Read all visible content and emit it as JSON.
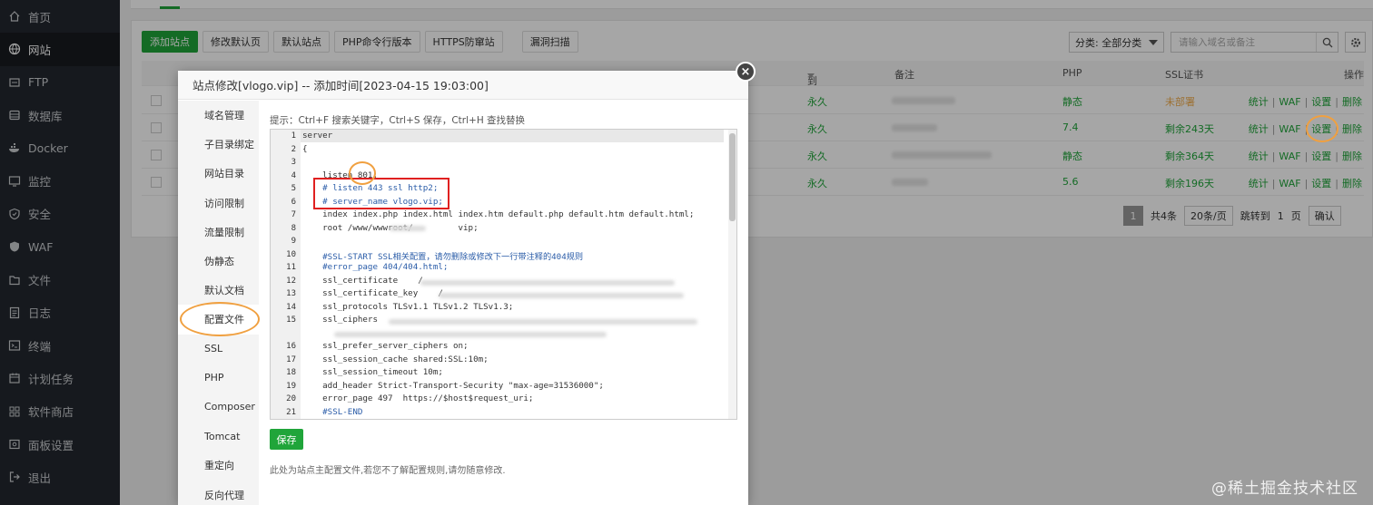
{
  "sidebar": {
    "items": [
      {
        "label": "首页",
        "icon": "home-icon"
      },
      {
        "label": "网站",
        "icon": "globe-icon",
        "active": true
      },
      {
        "label": "FTP",
        "icon": "ftp-icon"
      },
      {
        "label": "数据库",
        "icon": "database-icon"
      },
      {
        "label": "Docker",
        "icon": "docker-icon"
      },
      {
        "label": "监控",
        "icon": "monitor-icon"
      },
      {
        "label": "安全",
        "icon": "shield-icon"
      },
      {
        "label": "WAF",
        "icon": "waf-shield-icon"
      },
      {
        "label": "文件",
        "icon": "folder-icon"
      },
      {
        "label": "日志",
        "icon": "log-icon"
      },
      {
        "label": "终端",
        "icon": "terminal-icon"
      },
      {
        "label": "计划任务",
        "icon": "calendar-icon"
      },
      {
        "label": "软件商店",
        "icon": "store-icon"
      },
      {
        "label": "面板设置",
        "icon": "settings-icon"
      },
      {
        "label": "退出",
        "icon": "logout-icon"
      }
    ]
  },
  "toolbar": {
    "add_site": "添加站点",
    "modify_default": "修改默认页",
    "default_site": "默认站点",
    "php_cli": "PHP命令行版本",
    "https_protect": "HTTPS防窜站",
    "vuln_scan": "漏洞扫描",
    "category_select": "分类: 全部分类",
    "search_placeholder": "请输入域名或备注"
  },
  "table": {
    "headers": {
      "expire": "到期时间",
      "remark": "备注",
      "php": "PHP",
      "ssl": "SSL证书",
      "ops": "操作"
    },
    "rows": [
      {
        "expire": "永久",
        "php": "静态",
        "ssl": "未部署",
        "ssl_status": "warn"
      },
      {
        "expire": "永久",
        "php": "7.4",
        "ssl": "剩余243天",
        "ssl_status": "ok"
      },
      {
        "expire": "永久",
        "php": "静态",
        "ssl": "剩余364天",
        "ssl_status": "ok"
      },
      {
        "expire": "永久",
        "php": "5.6",
        "ssl": "剩余196天",
        "ssl_status": "ok"
      }
    ],
    "op_labels": {
      "stats": "统计",
      "waf": "WAF",
      "settings": "设置",
      "delete": "删除"
    },
    "pager": {
      "current": "1",
      "total": "共4条",
      "per_page": "20条/页",
      "goto": "跳转到",
      "goto_page": "1",
      "page_unit": "页",
      "confirm": "确认"
    }
  },
  "modal": {
    "title": "站点修改[vlogo.vip] -- 添加时间[2023-04-15 19:03:00]",
    "close_glyph": "×",
    "nav": [
      "域名管理",
      "子目录绑定",
      "网站目录",
      "访问限制",
      "流量限制",
      "伪静态",
      "默认文档",
      "配置文件",
      "SSL",
      "PHP",
      "Composer",
      "Tomcat",
      "重定向",
      "反向代理"
    ],
    "active_nav": "配置文件",
    "hint": "提示：Ctrl+F 搜索关键字，Ctrl+S 保存，Ctrl+H 查找替换",
    "save": "保存",
    "note": "此处为站点主配置文件,若您不了解配置规则,请勿随意修改.",
    "code_lines": [
      {
        "n": "1",
        "text": "server"
      },
      {
        "n": "2",
        "text": "{"
      },
      {
        "n": "3",
        "text": ""
      },
      {
        "n": "4",
        "text": "    listen 801;"
      },
      {
        "n": "5",
        "text": "    # listen 443 ssl http2;"
      },
      {
        "n": "6",
        "text": "    # server_name vlogo.vip;"
      },
      {
        "n": "7",
        "text": "    index index.php index.html index.htm default.php default.htm default.html;"
      },
      {
        "n": "8",
        "text": "    root /www/wwwroot/         vip;"
      },
      {
        "n": "9",
        "text": ""
      },
      {
        "n": "10",
        "text": "    #SSL-START SSL相关配置，请勿删除或修改下一行带注释的404规则"
      },
      {
        "n": "11",
        "text": "    #error_page 404/404.html;"
      },
      {
        "n": "12",
        "text": "    ssl_certificate    /"
      },
      {
        "n": "13",
        "text": "    ssl_certificate_key    /"
      },
      {
        "n": "14",
        "text": "    ssl_protocols TLSv1.1 TLSv1.2 TLSv1.3;"
      },
      {
        "n": "15",
        "text": "    ssl_ciphers"
      },
      {
        "n": "16",
        "text": "    ssl_prefer_server_ciphers on;"
      },
      {
        "n": "17",
        "text": "    ssl_session_cache shared:SSL:10m;"
      },
      {
        "n": "18",
        "text": "    ssl_session_timeout 10m;"
      },
      {
        "n": "19",
        "text": "    add_header Strict-Transport-Security \"max-age=31536000\";"
      },
      {
        "n": "20",
        "text": "    error_page 497  https://$host$request_uri;"
      },
      {
        "n": "21",
        "text": "    #SSL-END"
      }
    ]
  },
  "watermark": "@稀土掘金技术社区",
  "colors": {
    "accent": "#20a53a",
    "sidebar": "#23272e",
    "annotation_red": "#e02020",
    "annotation_orange": "#f0a040"
  }
}
